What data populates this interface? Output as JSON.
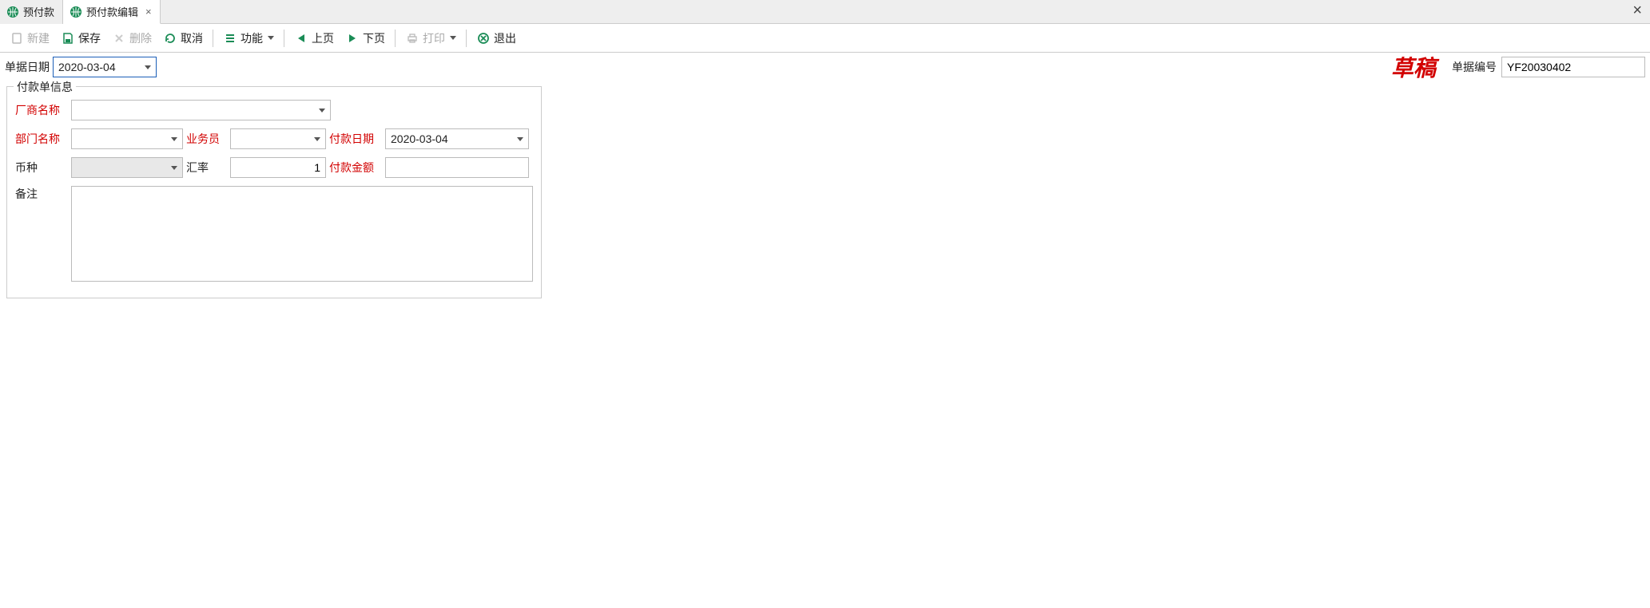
{
  "tabs": {
    "items": [
      {
        "label": "预付款"
      },
      {
        "label": "预付款编辑"
      }
    ]
  },
  "toolbar": {
    "new_label": "新建",
    "save_label": "保存",
    "delete_label": "删除",
    "cancel_label": "取消",
    "function_label": "功能",
    "prev_label": "上页",
    "next_label": "下页",
    "print_label": "打印",
    "exit_label": "退出"
  },
  "header": {
    "date_label": "单据日期",
    "date_value": "2020-03-04",
    "status_text": "草稿",
    "doc_no_label": "单据编号",
    "doc_no_value": "YF20030402"
  },
  "form": {
    "legend": "付款单信息",
    "vendor_label": "厂商名称",
    "vendor_value": "",
    "dept_label": "部门名称",
    "dept_value": "",
    "salesman_label": "业务员",
    "salesman_value": "",
    "paydate_label": "付款日期",
    "paydate_value": "2020-03-04",
    "currency_label": "币种",
    "currency_value": "",
    "rate_label": "汇率",
    "rate_value": "1",
    "amount_label": "付款金额",
    "amount_value": "",
    "remark_label": "备注",
    "remark_value": ""
  }
}
